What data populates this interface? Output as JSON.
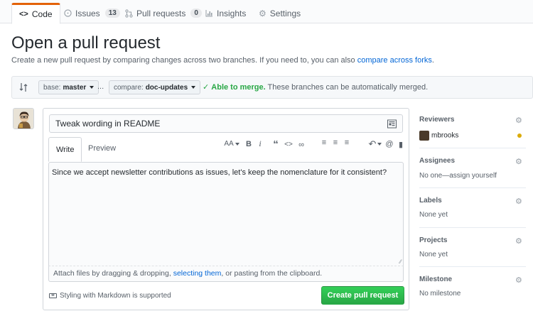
{
  "nav": {
    "tabs": [
      {
        "label": "Code",
        "icon": "code-icon"
      },
      {
        "label": "Issues",
        "icon": "issue-icon",
        "count": "13"
      },
      {
        "label": "Pull requests",
        "icon": "pull-request-icon",
        "count": "0"
      },
      {
        "label": "Insights",
        "icon": "graph-icon"
      },
      {
        "label": "Settings",
        "icon": "gear-icon"
      }
    ]
  },
  "header": {
    "title": "Open a pull request",
    "subtitle": "Create a new pull request by comparing changes across two branches. If you need to, you can also",
    "subtitle_link": "compare across forks",
    "subtitle_end": "."
  },
  "compare": {
    "base_label": "base:",
    "base_value": "master",
    "dots": "...",
    "compare_label": "compare:",
    "compare_value": "doc-updates",
    "merge_ok": "Able to merge.",
    "merge_text": "These branches can be automatically merged.",
    "ok_color": "#28a745"
  },
  "composer": {
    "title_value": "Tweak wording in README",
    "tab_write": "Write",
    "tab_preview": "Preview",
    "body_value": "Since we accept newsletter contributions as issues, let's keep the nomenclature for it consistent?",
    "attach_before": "Attach files by dragging & dropping, ",
    "attach_link": "selecting them",
    "attach_after": ", or pasting from the clipboard.",
    "markdown_hint": "Styling with Markdown is supported",
    "submit_label": "Create pull request",
    "toolbar": {
      "header": "AA",
      "bold": "B",
      "italic": "i",
      "quote": "“",
      "code": "<>",
      "link": "∞",
      "ul": "≡",
      "ol": "≡",
      "task": "≡",
      "reply": "↶",
      "mention": "@",
      "bookmark": "▮"
    }
  },
  "sidebar": {
    "reviewers": {
      "label": "Reviewers",
      "user": "mbrooks"
    },
    "assignees": {
      "label": "Assignees",
      "value": "No one—assign yourself"
    },
    "labels": {
      "label": "Labels",
      "value": "None yet"
    },
    "projects": {
      "label": "Projects",
      "value": "None yet"
    },
    "milestone": {
      "label": "Milestone",
      "value": "No milestone"
    }
  }
}
